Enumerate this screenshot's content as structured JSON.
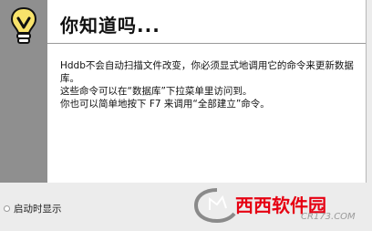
{
  "dialog": {
    "title": "你知道吗...",
    "tip_line_1": "Hddb不会自动扫描文件改变，你必须显式地调用它的命令来更新数据库。",
    "tip_line_2": "这些命令可以在“数据库”下拉菜单里访问到。",
    "tip_line_3": "你也可以简单地按下 F7 来调用“全部建立”命令。",
    "show_on_startup_label": "启动时显示",
    "show_on_startup_checked": false
  },
  "icons": {
    "tip": "lightbulb-icon",
    "watermark": "site-watermark-logo"
  },
  "colors": {
    "sidebar": "#8f8f8f",
    "content_background": "#ffffff",
    "dialog_background": "#ececec",
    "watermark_red": "#e60012",
    "watermark_green": "#3aa900"
  },
  "watermark": {
    "brand": "西西软件园",
    "domain": "CR173.COM"
  }
}
